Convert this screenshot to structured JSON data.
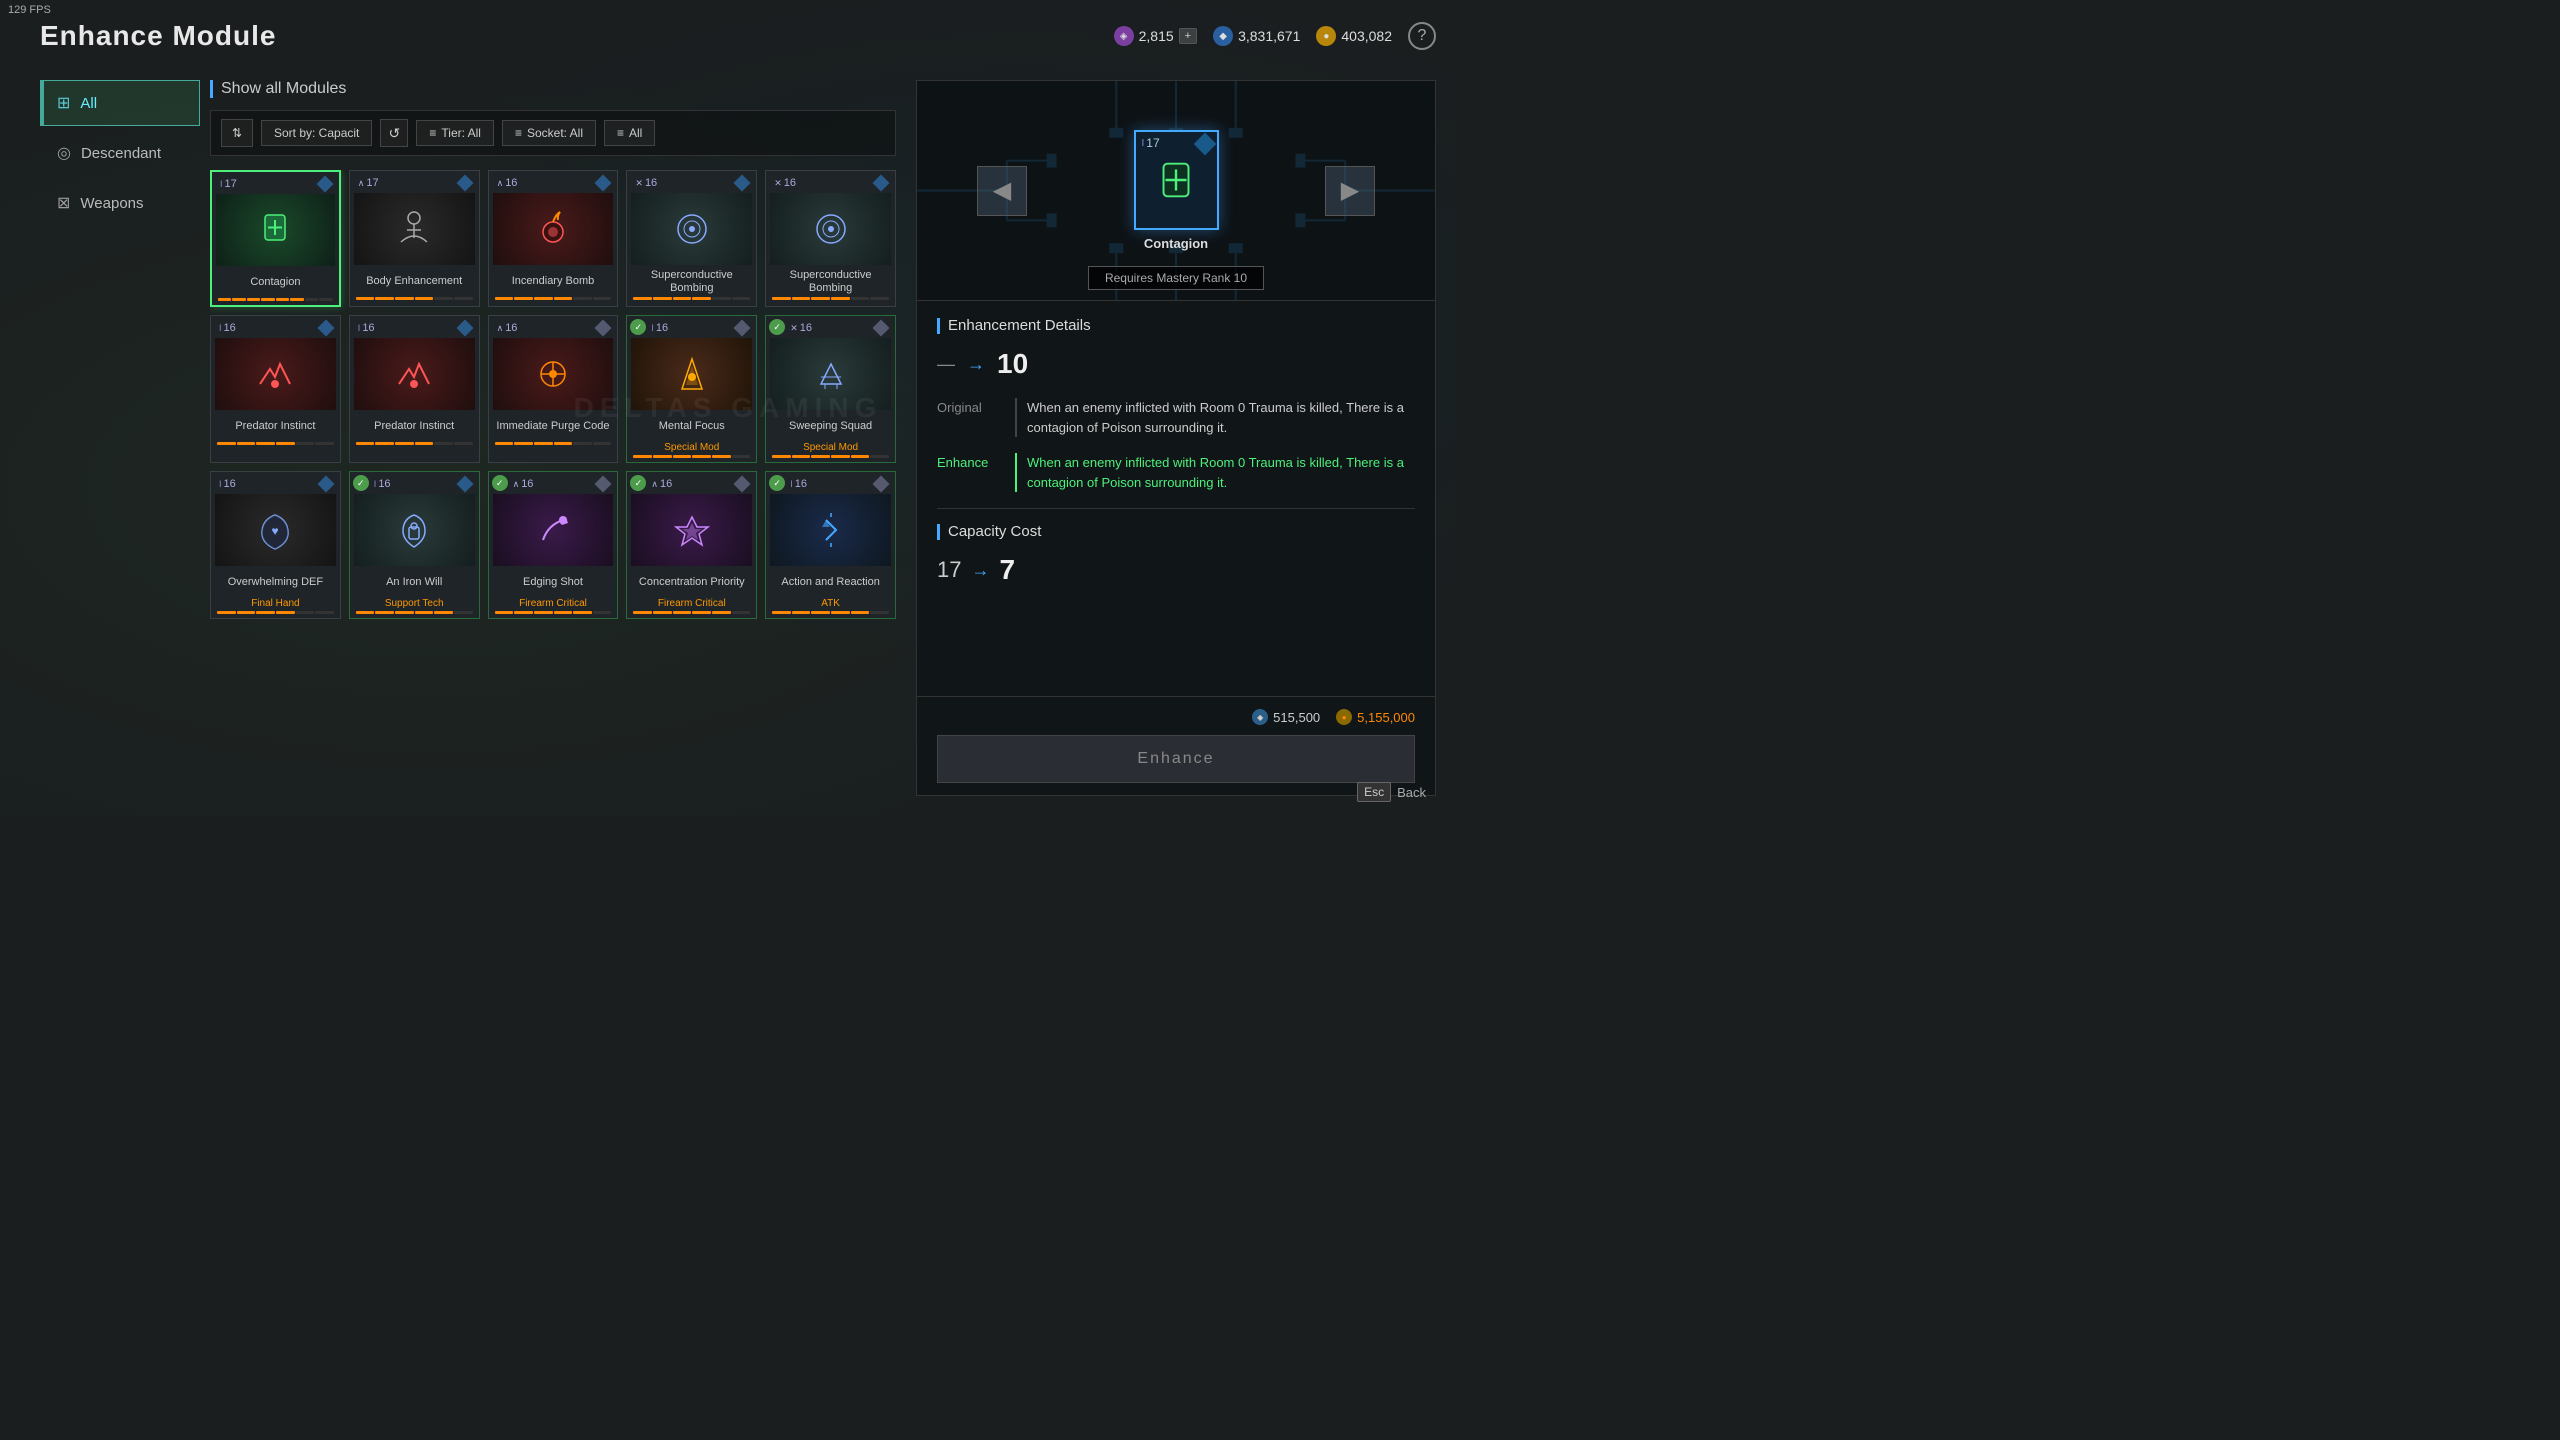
{
  "fps": "129 FPS",
  "title": "Enhance Module",
  "currency": {
    "purple": {
      "value": "2,815",
      "icon": "◈",
      "color": "#7b3fa0"
    },
    "blue": {
      "value": "3,831,671",
      "icon": "◆",
      "color": "#2a5fa0"
    },
    "gold": {
      "value": "403,082",
      "icon": "●",
      "color": "#b8860b"
    }
  },
  "sidebar": {
    "items": [
      {
        "id": "all",
        "label": "All",
        "active": true,
        "icon": "⊞"
      },
      {
        "id": "descendant",
        "label": "Descendant",
        "active": false,
        "icon": "◎"
      },
      {
        "id": "weapons",
        "label": "Weapons",
        "active": false,
        "icon": "⊠"
      }
    ]
  },
  "filter": {
    "show_label": "Show all Modules",
    "sort_label": "Sort by: Capacit",
    "tier_label": "Tier: All",
    "socket_label": "Socket: All",
    "all_label": "All"
  },
  "modules": [
    {
      "id": 1,
      "name": "Contagion",
      "rank": "17",
      "rank_icon": "I",
      "bg": "green",
      "icon": "✚",
      "selected": true,
      "equipped": false,
      "cap_dots": 8,
      "cap_filled": 6
    },
    {
      "id": 2,
      "name": "Body Enhancement",
      "rank": "17",
      "rank_icon": "∧",
      "bg": "dark",
      "icon": "👤",
      "selected": false,
      "equipped": false,
      "cap_dots": 6,
      "cap_filled": 4
    },
    {
      "id": 3,
      "name": "Incendiary Bomb",
      "rank": "16",
      "rank_icon": "∧",
      "bg": "red",
      "icon": "💣",
      "selected": false,
      "equipped": false,
      "cap_dots": 6,
      "cap_filled": 4
    },
    {
      "id": 4,
      "name": "Superconductive Bombing",
      "rank": "16",
      "rank_icon": "✕",
      "bg": "gray",
      "icon": "◉",
      "selected": false,
      "equipped": false,
      "cap_dots": 6,
      "cap_filled": 4
    },
    {
      "id": 5,
      "name": "Superconductive Bombing",
      "rank": "16",
      "rank_icon": "✕",
      "bg": "gray",
      "icon": "◉",
      "selected": false,
      "equipped": false,
      "cap_dots": 6,
      "cap_filled": 4
    },
    {
      "id": 6,
      "name": "Predator Instinct",
      "rank": "16",
      "rank_icon": "I",
      "bg": "red",
      "icon": "🐾",
      "selected": false,
      "equipped": false,
      "cap_dots": 6,
      "cap_filled": 4
    },
    {
      "id": 7,
      "name": "Predator Instinct",
      "rank": "16",
      "rank_icon": "I",
      "bg": "red",
      "icon": "🐾",
      "selected": false,
      "equipped": false,
      "cap_dots": 6,
      "cap_filled": 4
    },
    {
      "id": 8,
      "name": "Immediate Purge Code",
      "rank": "16",
      "rank_icon": "∧",
      "bg": "red",
      "icon": "⊛",
      "selected": false,
      "equipped": false,
      "cap_dots": 6,
      "cap_filled": 4
    },
    {
      "id": 9,
      "name": "Mental Focus",
      "rank": "16",
      "rank_icon": "I",
      "bg": "orange",
      "icon": "◈",
      "selected": false,
      "equipped": true,
      "subtype": "Special Mod",
      "cap_dots": 6,
      "cap_filled": 5
    },
    {
      "id": 10,
      "name": "Sweeping Squad",
      "rank": "16",
      "rank_icon": "✕",
      "bg": "gray",
      "icon": "⊿",
      "selected": false,
      "equipped": true,
      "subtype": "Special Mod",
      "cap_dots": 6,
      "cap_filled": 5
    },
    {
      "id": 11,
      "name": "Overwhelming DEF",
      "rank": "16",
      "rank_icon": "I",
      "bg": "dark",
      "icon": "♥",
      "selected": false,
      "equipped": false,
      "subtype": "Final Hand",
      "cap_dots": 6,
      "cap_filled": 4
    },
    {
      "id": 12,
      "name": "An Iron Will",
      "rank": "16",
      "rank_icon": "I",
      "bg": "gray",
      "icon": "⊡",
      "selected": false,
      "equipped": true,
      "subtype": "Support Tech",
      "cap_dots": 6,
      "cap_filled": 5
    },
    {
      "id": 13,
      "name": "Edging Shot",
      "rank": "16",
      "rank_icon": "∧",
      "bg": "purple",
      "icon": "⟳",
      "selected": false,
      "equipped": true,
      "subtype": "Firearm Critical",
      "cap_dots": 6,
      "cap_filled": 5
    },
    {
      "id": 14,
      "name": "Concentration Priority",
      "rank": "16",
      "rank_icon": "∧",
      "bg": "purple",
      "icon": "✦",
      "selected": false,
      "equipped": true,
      "subtype": "Firearm Critical",
      "cap_dots": 6,
      "cap_filled": 5
    },
    {
      "id": 15,
      "name": "Action and Reaction",
      "rank": "16",
      "rank_icon": "I",
      "bg": "blue",
      "icon": "↑",
      "selected": false,
      "equipped": true,
      "subtype": "ATK",
      "cap_dots": 6,
      "cap_filled": 5
    }
  ],
  "preview": {
    "rank": "17",
    "rank_icon": "I",
    "icon": "✦",
    "name": "Contagion",
    "mastery_text": "Requires Mastery Rank 10"
  },
  "enhancement": {
    "section_title": "Enhancement Details",
    "level_dash": "—",
    "level_arrow": "→",
    "level_value": "10",
    "original_label": "Original",
    "original_text": "When an enemy inflicted with Room 0 Trauma is killed, There is a contagion of Poison surrounding it.",
    "enhance_label": "Enhance",
    "enhance_text": "When an enemy inflicted with Room 0 Trauma is killed, There is a contagion of Poison surrounding it.",
    "capacity_title": "Capacity Cost",
    "cap_original": "17",
    "cap_arrow": "→",
    "cap_new": "7"
  },
  "action": {
    "cost_crystal": "515,500",
    "cost_gold": "5,155,000",
    "enhance_button": "Enhance"
  },
  "esc_key": "Esc",
  "back_label": "Back",
  "watermark": "DELTAS  GAMING"
}
